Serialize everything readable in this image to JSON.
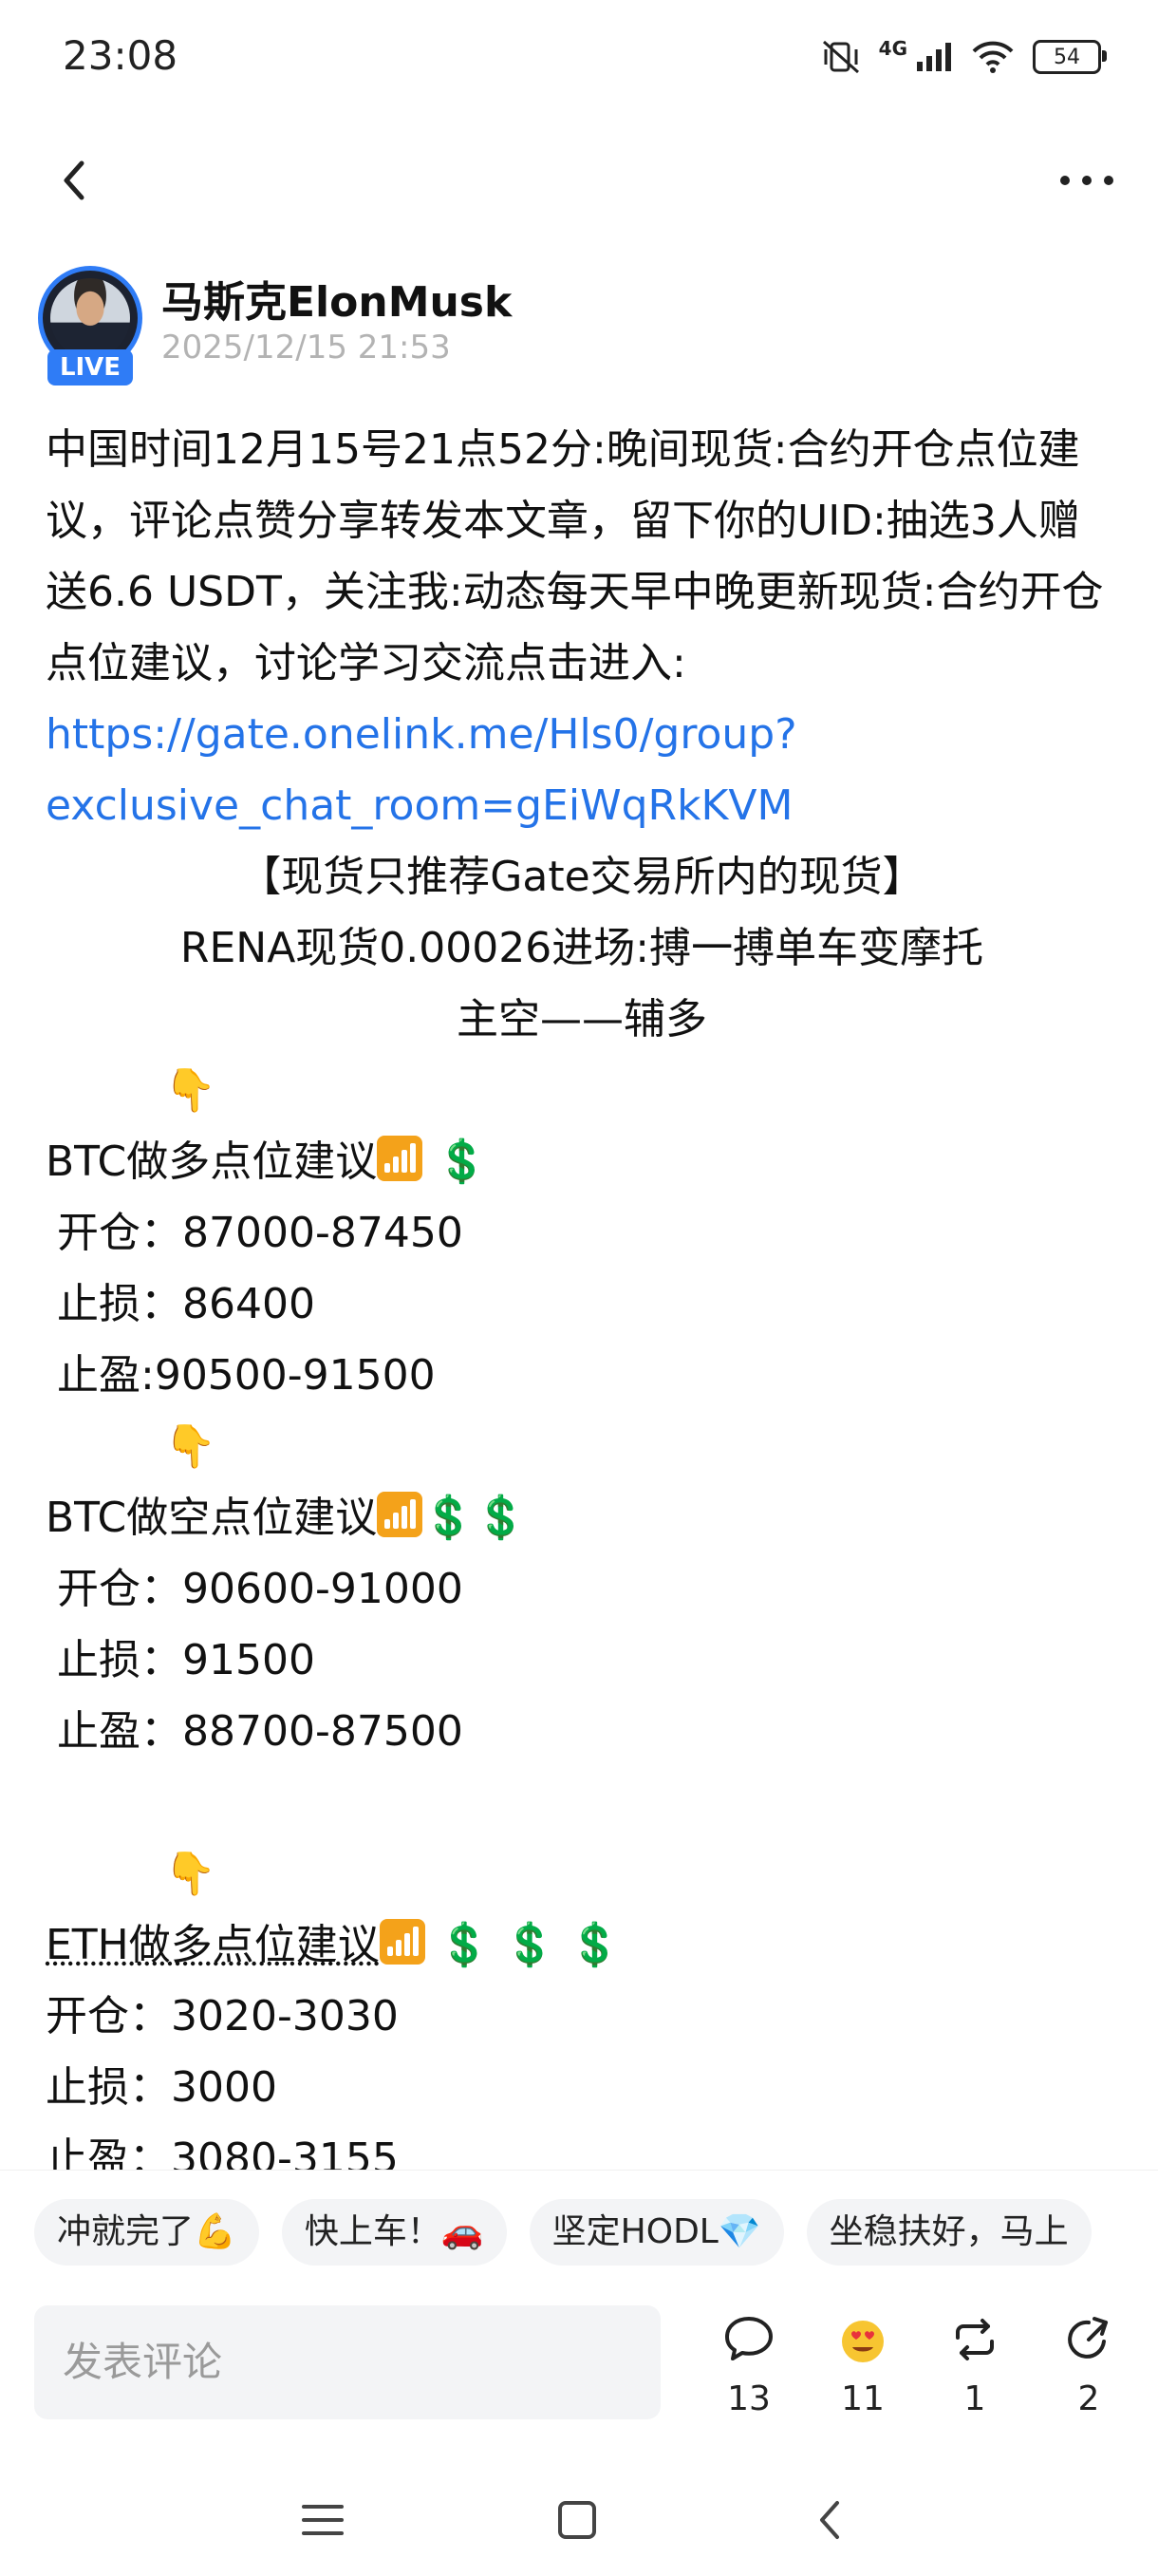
{
  "status_bar": {
    "time": "23:08",
    "network": "4G",
    "battery": "54"
  },
  "author": {
    "name": "马斯克ElonMusk",
    "date": "2025/12/15 21:53",
    "live_badge": "LIVE"
  },
  "post": {
    "intro": "中国时间12月15号21点52分:晚间现货:合约开仓点位建议，评论点赞分享转发本文章，留下你的UID:抽选3人赠送6.6 USDT，关注我:动态每天早中晚更新现货:合约开仓点位建议，讨论学习交流点击进入: ",
    "link": "https://gate.onelink.me/Hls0/group?exclusive_chat_room=gEiWqRkKVM",
    "headline": "【现货只推荐Gate交易所内的现货】",
    "rena_line": "RENA现货0.00026进场:搏一搏单车变摩托",
    "bias": "主空——辅多",
    "pointer_emoji": "👇",
    "btc_long": {
      "title": "BTC做多点位建议",
      "open": "开仓：87000-87450",
      "stop_loss": "止损：86400",
      "take_profit": "止盈:90500-91500"
    },
    "btc_short": {
      "title": "BTC做空点位建议",
      "open": "开仓：90600-91000",
      "stop_loss": "止损：91500",
      "take_profit": "止盈：88700-87500"
    },
    "eth_long": {
      "title": "ETH做多点位建议",
      "open": "开仓：3020-3030",
      "stop_loss": "止损：3000",
      "take_profit": "止盈：3080-3155"
    },
    "dollar": "💲"
  },
  "quick_replies": [
    "冲就完了💪",
    "快上车！🚗",
    "坚定HODL💎",
    "坐稳扶好，马上"
  ],
  "comment_placeholder": "发表评论",
  "actions": {
    "comments": "13",
    "reactions": "11",
    "reposts": "1",
    "shares": "2"
  },
  "colors": {
    "accent": "#2f7cf6",
    "link": "#2473e8",
    "dollar": "#1a9e48"
  }
}
